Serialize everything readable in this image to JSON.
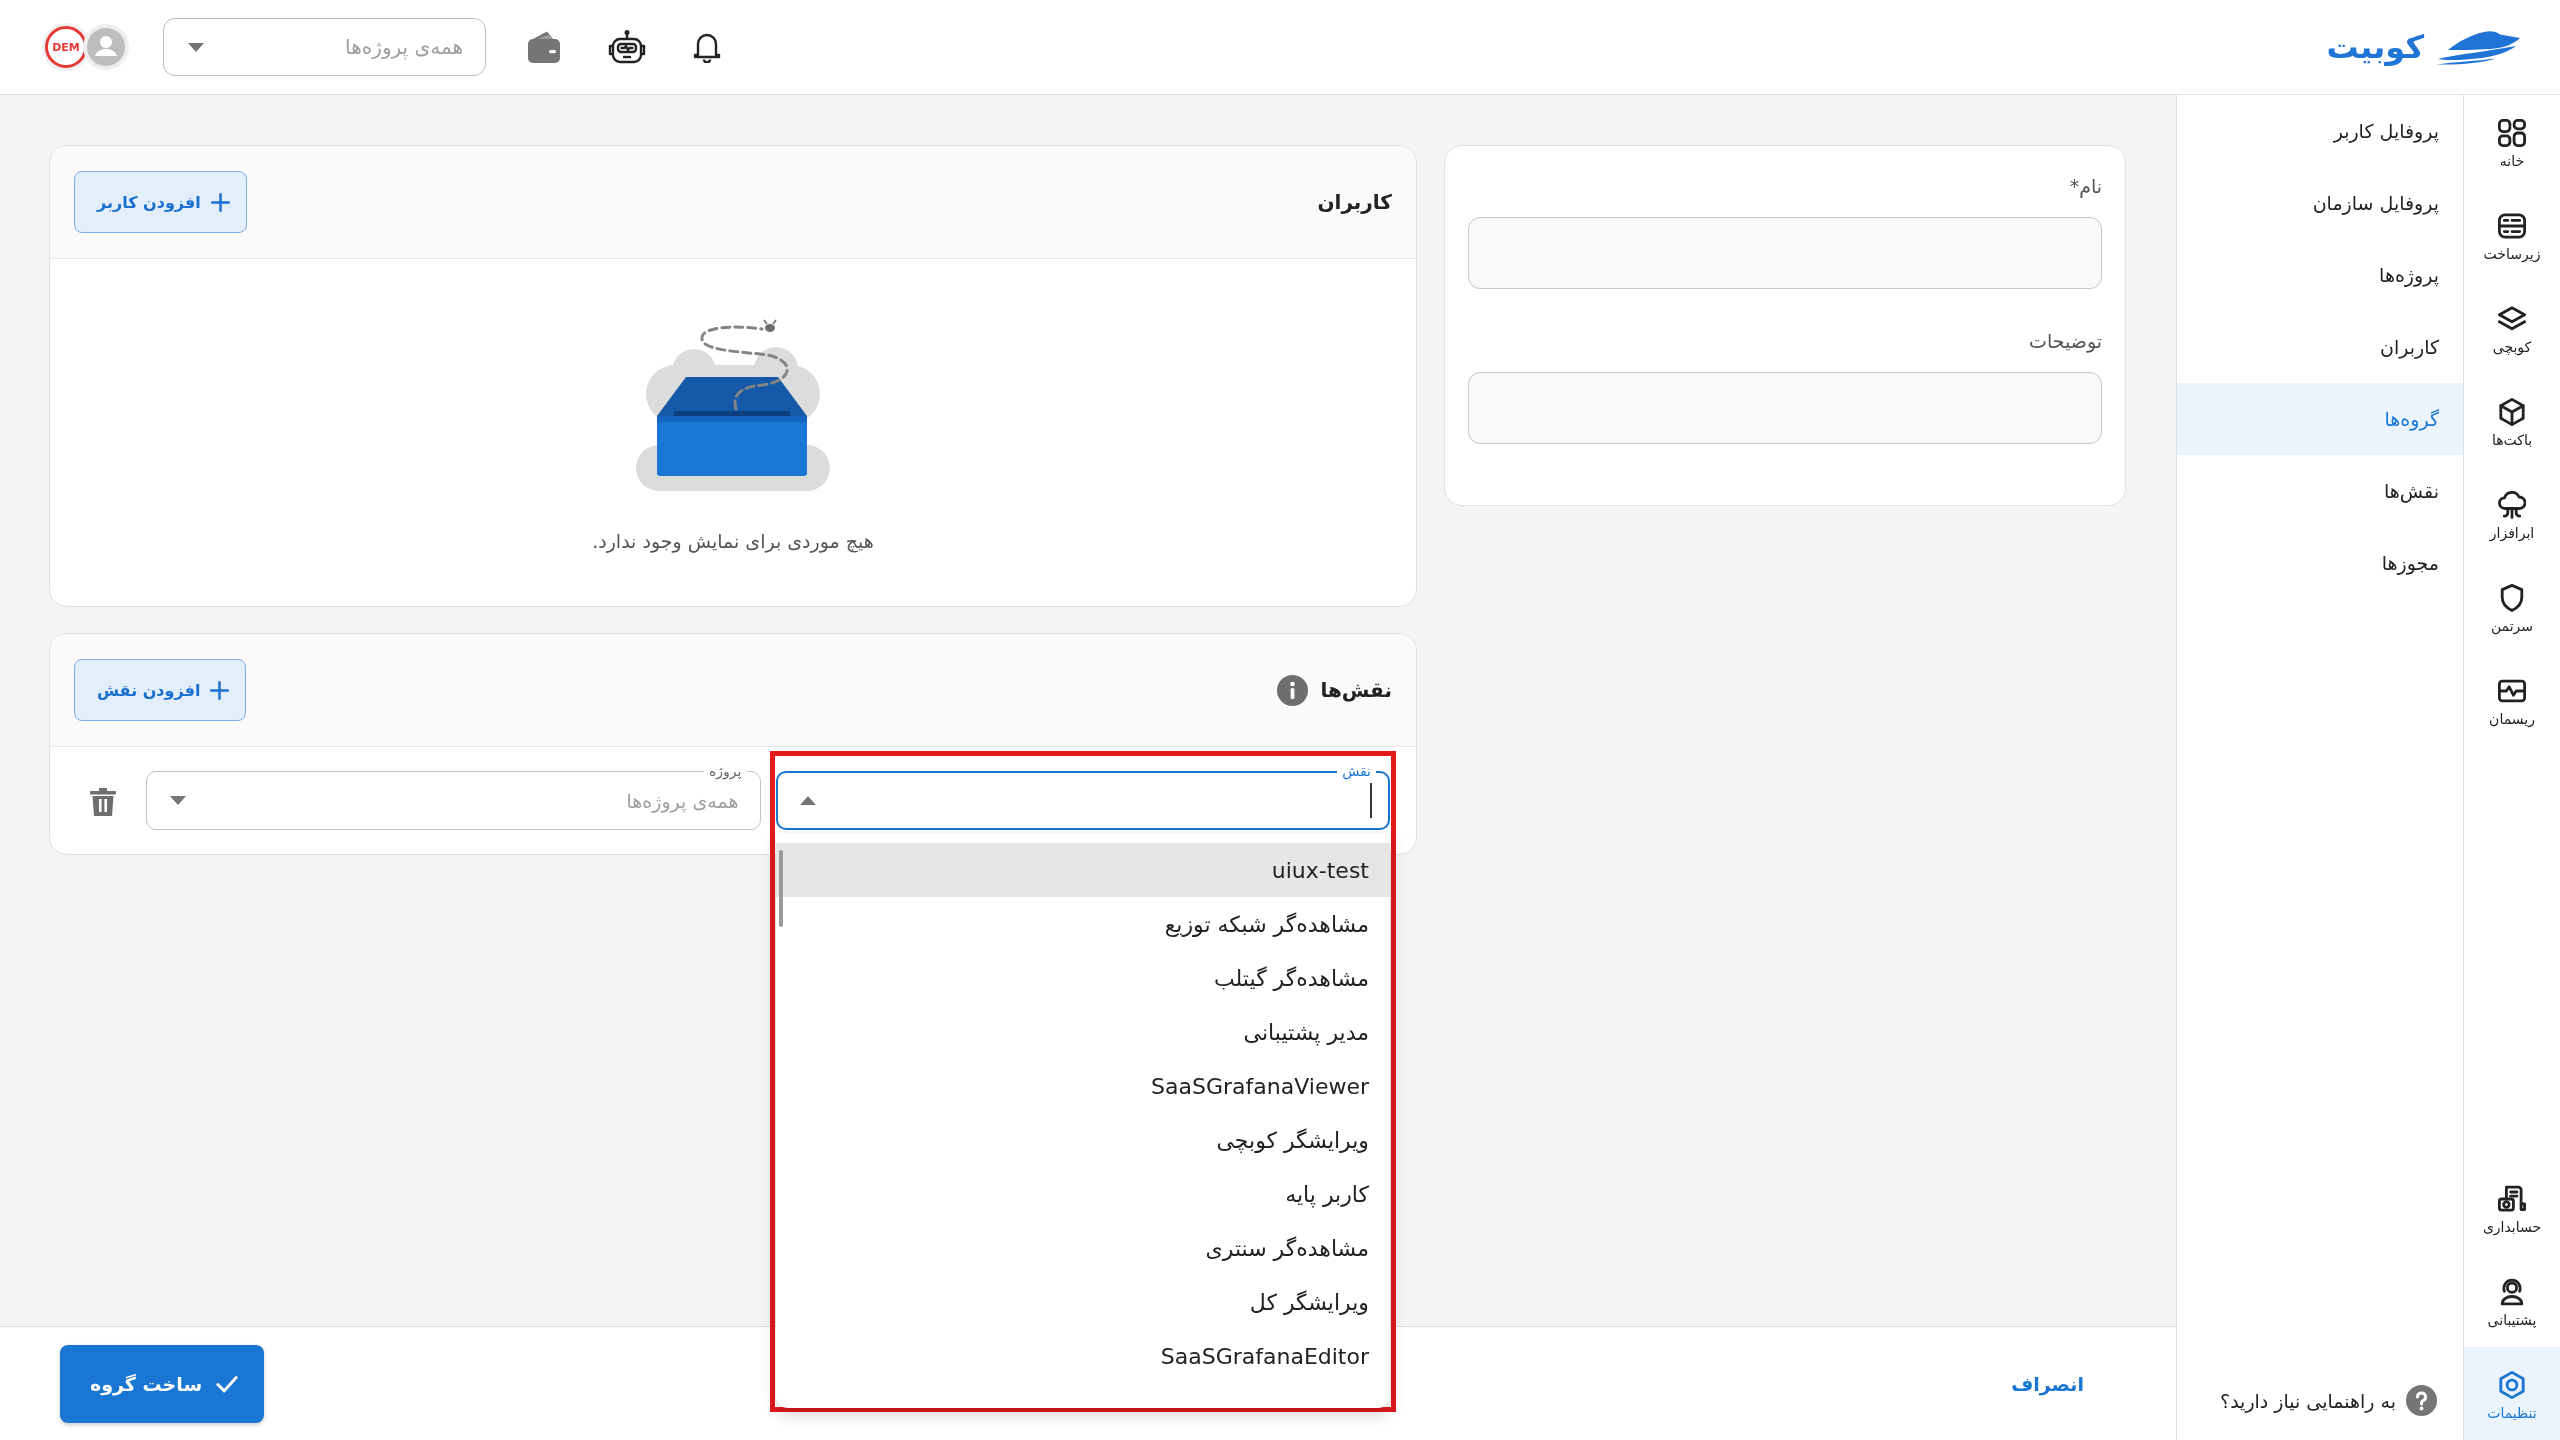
{
  "header": {
    "logo": "کوبیت",
    "project_select": {
      "placeholder": "همه‌ی پروژه‌ها"
    },
    "demo_stamp": "DEM"
  },
  "nav_rail": {
    "items": [
      {
        "label": "خانه",
        "selected": false
      },
      {
        "label": "زیرساخت",
        "selected": false
      },
      {
        "label": "کوبچی",
        "selected": false
      },
      {
        "label": "باکت‌ها",
        "selected": false
      },
      {
        "label": "ابرافزار",
        "selected": false
      },
      {
        "label": "سرتمن",
        "selected": false
      },
      {
        "label": "ریسمان",
        "selected": false
      }
    ],
    "bottom_items": [
      {
        "label": "حسابداری",
        "selected": false
      },
      {
        "label": "پشتیبانی",
        "selected": false
      },
      {
        "label": "تنظیمات",
        "selected": true
      }
    ]
  },
  "submenu": {
    "items": [
      {
        "label": "پروفایل کاربر",
        "selected": false
      },
      {
        "label": "پروفایل سازمان",
        "selected": false
      },
      {
        "label": "پروژه‌ها",
        "selected": false
      },
      {
        "label": "کاربران",
        "selected": false
      },
      {
        "label": "گروه‌ها",
        "selected": true
      },
      {
        "label": "نقش‌ها",
        "selected": false
      },
      {
        "label": "مجوزها",
        "selected": false
      }
    ],
    "help": "به راهنمایی نیاز دارید؟"
  },
  "group_form": {
    "fields": [
      {
        "label": "نام*"
      },
      {
        "label": "توضیحات"
      }
    ]
  },
  "users": {
    "title": "کاربران",
    "add_button": "افزودن کاربر",
    "empty_message": "هیچ موردی برای نمایش وجود ندارد."
  },
  "roles": {
    "title": "نقش‌ها",
    "add_button": "افزودن نقش",
    "rows": [
      {
        "project_select": {
          "label": "پروژه",
          "placeholder": "همه‌ی پروژه‌ها"
        },
        "role_select": {
          "label": "نقش",
          "focused": true,
          "expanded": true,
          "highlighted": true,
          "options": [
            {
              "label": "uiux-test",
              "selected": true
            },
            {
              "label": "مشاهده‌گر شبکه توزیع",
              "selected": false
            },
            {
              "label": "مشاهده‌گر گیتلب",
              "selected": false
            },
            {
              "label": "مدیر پشتیبانی",
              "selected": false
            },
            {
              "label": "SaaSGrafanaViewer",
              "selected": false
            },
            {
              "label": "ویرایشگر کوبچی",
              "selected": false
            },
            {
              "label": "کاربر پایه",
              "selected": false
            },
            {
              "label": "مشاهده‌گر سنتری",
              "selected": false
            },
            {
              "label": "ویرایشگر کل",
              "selected": false
            },
            {
              "label": "SaaSGrafanaEditor",
              "selected": false
            }
          ]
        }
      }
    ]
  },
  "actions": {
    "cancel": "انصراف",
    "submit": "ساخت گروه"
  }
}
